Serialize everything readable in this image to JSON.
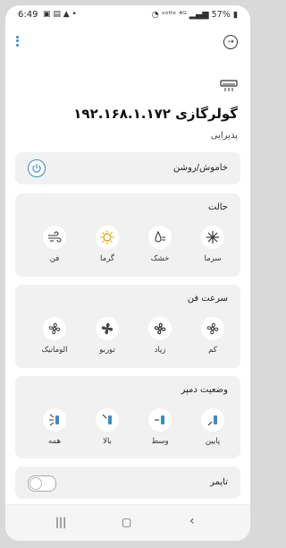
{
  "status_bar": {
    "time": "6:49",
    "battery": "57%"
  },
  "device": {
    "title": "گولرگازی ۱۹۲.۱۶۸.۱.۱۷۲",
    "subtitle": "پذیرایی"
  },
  "power": {
    "label": "خاموش/روشن"
  },
  "mode": {
    "title": "حالت",
    "items": [
      {
        "label": "سرما",
        "icon": "snowflake-icon"
      },
      {
        "label": "خشک",
        "icon": "dry-icon"
      },
      {
        "label": "گرما",
        "icon": "sun-icon"
      },
      {
        "label": "فن",
        "icon": "wind-icon"
      }
    ]
  },
  "fan_speed": {
    "title": "سرعت فن",
    "items": [
      {
        "label": "کم",
        "icon": "fan-low-icon"
      },
      {
        "label": "زیاد",
        "icon": "fan-high-icon"
      },
      {
        "label": "توربو",
        "icon": "fan-turbo-icon"
      },
      {
        "label": "الوماتیک",
        "icon": "fan-auto-icon"
      }
    ]
  },
  "damper": {
    "title": "وضعیت دمپر",
    "items": [
      {
        "label": "پایین",
        "icon": "damper-down-icon"
      },
      {
        "label": "وسط",
        "icon": "damper-middle-icon"
      },
      {
        "label": "بالا",
        "icon": "damper-up-icon"
      },
      {
        "label": "همه",
        "icon": "damper-all-icon"
      }
    ]
  },
  "timer": {
    "label": "تایمر",
    "enabled": false
  },
  "colors": {
    "accent": "#3a8ccc",
    "card": "#f1f1f1",
    "sun": "#e0a800"
  }
}
